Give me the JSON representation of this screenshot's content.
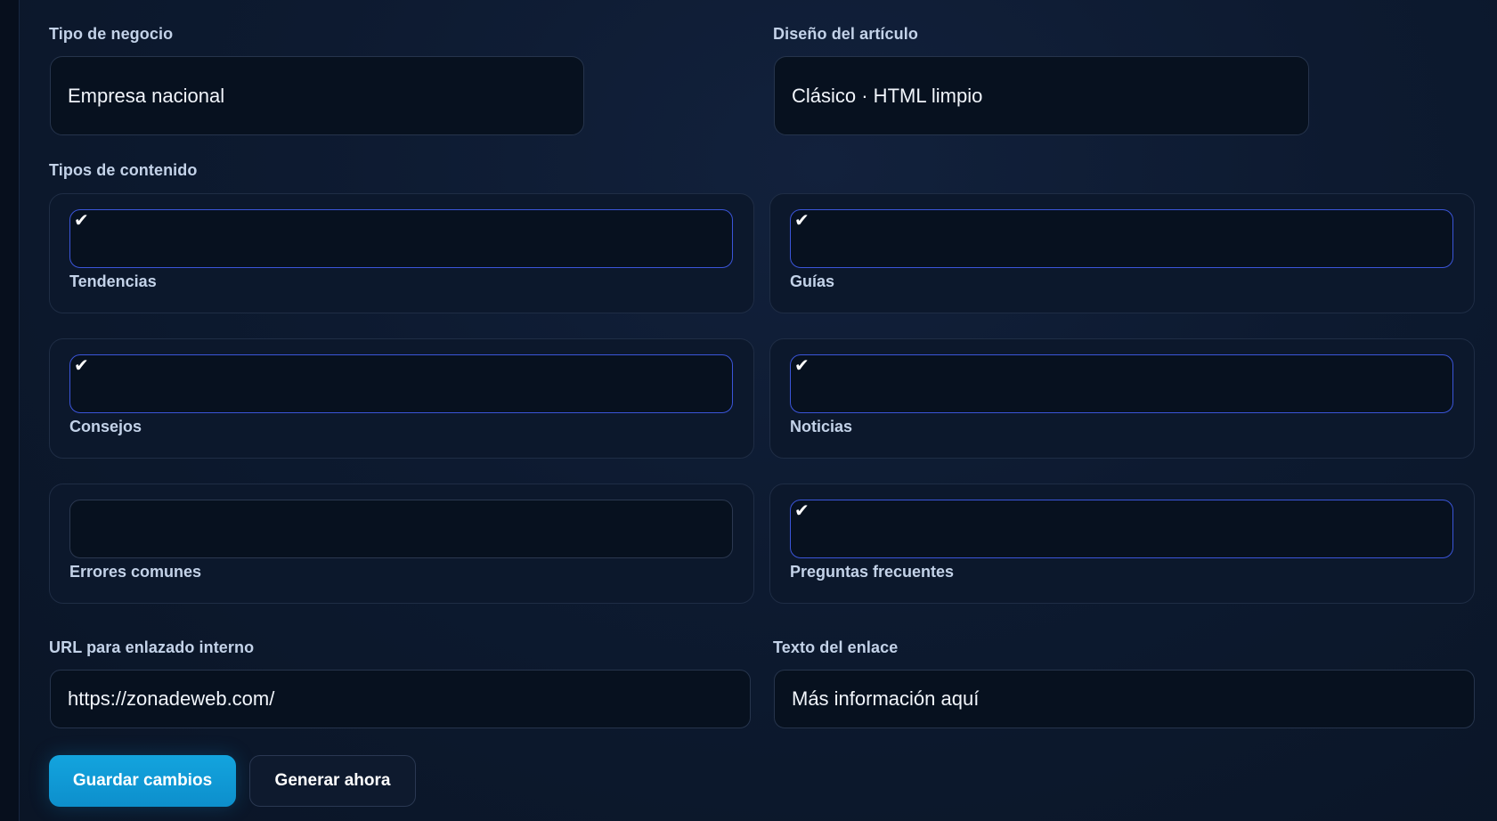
{
  "business_type": {
    "label": "Tipo de negocio",
    "value": "Empresa nacional"
  },
  "article_design": {
    "label": "Diseño del artículo",
    "value": "Clásico · HTML limpio"
  },
  "content_types": {
    "label": "Tipos de contenido",
    "items": [
      {
        "label": "Tendencias",
        "checked": true
      },
      {
        "label": "Guías",
        "checked": true
      },
      {
        "label": "Consejos",
        "checked": true
      },
      {
        "label": "Noticias",
        "checked": true
      },
      {
        "label": "Errores comunes",
        "checked": false
      },
      {
        "label": "Preguntas frecuentes",
        "checked": true
      }
    ],
    "check_glyph": "✔"
  },
  "internal_link": {
    "label": "URL para enlazado interno",
    "value": "https://zonadeweb.com/"
  },
  "link_text": {
    "label": "Texto del enlace",
    "value": "Más información aquí"
  },
  "actions": {
    "save_label": "Guardar cambios",
    "generate_label": "Generar ahora"
  },
  "colors": {
    "accent": "#13a4de",
    "checkbox_border": "#3b55d9",
    "background": "#0b1729"
  }
}
